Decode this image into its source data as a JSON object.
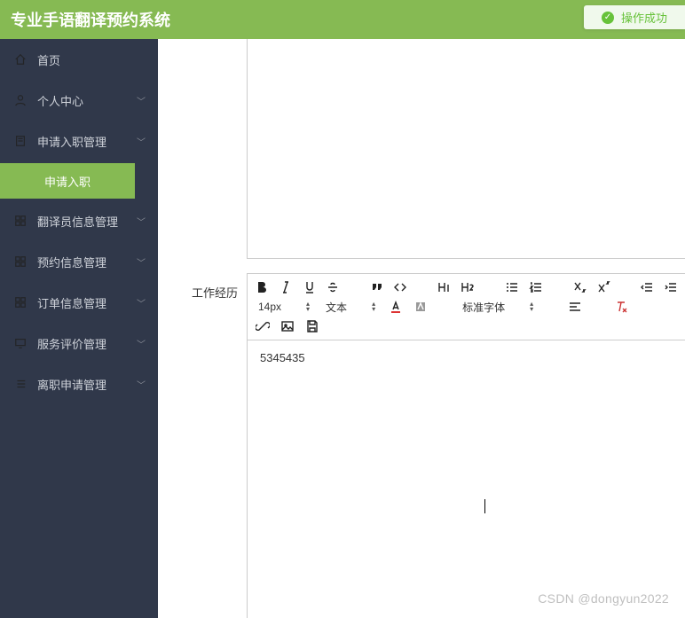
{
  "header": {
    "app_title": "专业手语翻译预约系统",
    "toast_text": "操作成功"
  },
  "sidebar": {
    "home_label": "首页",
    "items": [
      {
        "label": "个人中心",
        "icon": "user"
      },
      {
        "label": "申请入职管理",
        "icon": "form",
        "open": true,
        "children": [
          {
            "label": "申请入职"
          }
        ]
      },
      {
        "label": "翻译员信息管理",
        "icon": "grid"
      },
      {
        "label": "预约信息管理",
        "icon": "grid"
      },
      {
        "label": "订单信息管理",
        "icon": "grid"
      },
      {
        "label": "服务评价管理",
        "icon": "monitor"
      },
      {
        "label": "离职申请管理",
        "icon": "list"
      }
    ]
  },
  "form": {
    "field_work_label": "工作经历",
    "editor_value": "5345435"
  },
  "toolbar": {
    "font_size_value": "14px",
    "paragraph_value": "文本",
    "font_family_value": "标准字体"
  },
  "watermark": "CSDN @dongyun2022"
}
